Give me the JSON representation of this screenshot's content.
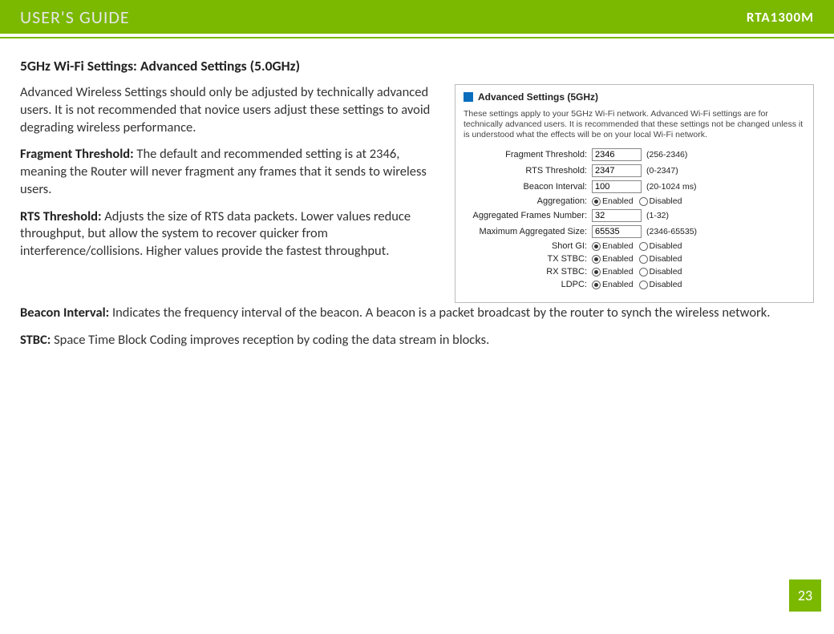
{
  "header": {
    "left": "USER'S GUIDE",
    "right": "RTA1300M"
  },
  "section_title": "5GHz Wi-Fi Settings: Advanced Settings (5.0GHz)",
  "intro": "Advanced Wireless Settings should only be adjusted by technically advanced users. It is not recommended that novice users adjust these settings to avoid degrading wireless performance.",
  "frag_label": "Fragment Threshold:",
  "frag_text": " The default and recommended setting is at 2346, meaning the Router will never fragment any frames that it sends to wireless users.",
  "rts_label": "RTS Threshold:",
  "rts_text": " Adjusts the size of RTS data packets. Lower values reduce throughput, but allow the system to recover quicker from interference/collisions. Higher values provide the fastest throughput.",
  "beacon_label": "Beacon Interval:",
  "beacon_text": " Indicates the frequency interval of the beacon. A beacon is a packet broadcast by the router to synch the wireless network.",
  "stbc_label": "STBC:",
  "stbc_text": " Space Time Block Coding improves reception by coding the data stream in blocks.",
  "panel": {
    "title": "Advanced Settings (5GHz)",
    "desc": "These settings apply to your 5GHz Wi-Fi network. Advanced Wi-Fi settings are for technically advanced users. It is recommended that these settings not be changed unless it is understood what the effects will be on your local Wi-Fi network.",
    "rows": {
      "frag": {
        "label": "Fragment Threshold:",
        "value": "2346",
        "hint": "(256-2346)"
      },
      "rts": {
        "label": "RTS Threshold:",
        "value": "2347",
        "hint": "(0-2347)"
      },
      "beacon": {
        "label": "Beacon Interval:",
        "value": "100",
        "hint": "(20-1024 ms)"
      },
      "aggregation": {
        "label": "Aggregation:"
      },
      "agg_frames": {
        "label": "Aggregated Frames Number:",
        "value": "32",
        "hint": "(1-32)"
      },
      "max_agg": {
        "label": "Maximum Aggregated Size:",
        "value": "65535",
        "hint": "(2346-65535)"
      },
      "short_gi": {
        "label": "Short GI:"
      },
      "tx_stbc": {
        "label": "TX STBC:"
      },
      "rx_stbc": {
        "label": "RX STBC:"
      },
      "ldpc": {
        "label": "LDPC:"
      }
    },
    "enabled": "Enabled",
    "disabled": "Disabled"
  },
  "page_number": "23"
}
